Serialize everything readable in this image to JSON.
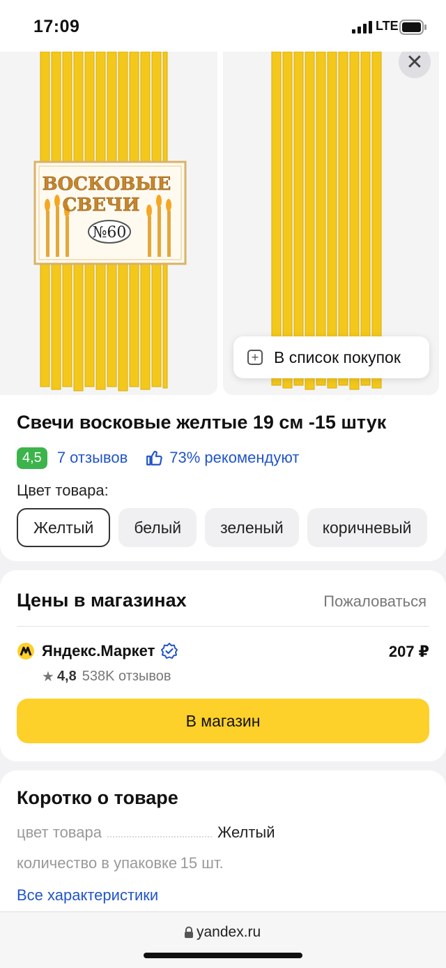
{
  "status_bar": {
    "time": "17:09",
    "network": "LTE"
  },
  "gallery": {
    "shopping_list_label": "В список покупок",
    "close_label": "✕"
  },
  "product": {
    "title": "Свечи восковые желтые 19 см -15 штук",
    "rating": "4,5",
    "reviews": "7 отзывов",
    "recommend": "73% рекомендуют",
    "color_label": "Цвет товара:",
    "colors": [
      "Желтый",
      "белый",
      "зеленый",
      "коричневый"
    ],
    "package_text": {
      "line1": "ВОСКОВЫЕ",
      "line2": "СВЕЧИ",
      "number": "№60"
    }
  },
  "prices": {
    "title": "Цены в магазинах",
    "complain": "Пожаловаться",
    "shop_name": "Яндекс.Маркет",
    "price": "207 ₽",
    "shop_rating": "4,8",
    "shop_reviews": "538K отзывов",
    "button": "В магазин"
  },
  "brief": {
    "title": "Коротко о товаре",
    "spec1_key": "цвет товара",
    "spec1_value": "Желтый",
    "spec2_key": "количество в упаковке",
    "spec2_value": "15 шт.",
    "all_specs": "Все характеристики"
  },
  "browser": {
    "url": "yandex.ru"
  },
  "colors": {
    "accent_yellow": "#fdd02a",
    "rating_green": "#3cb44b",
    "link_blue": "#2155c8",
    "candle_yellow": "#f3c81b"
  }
}
